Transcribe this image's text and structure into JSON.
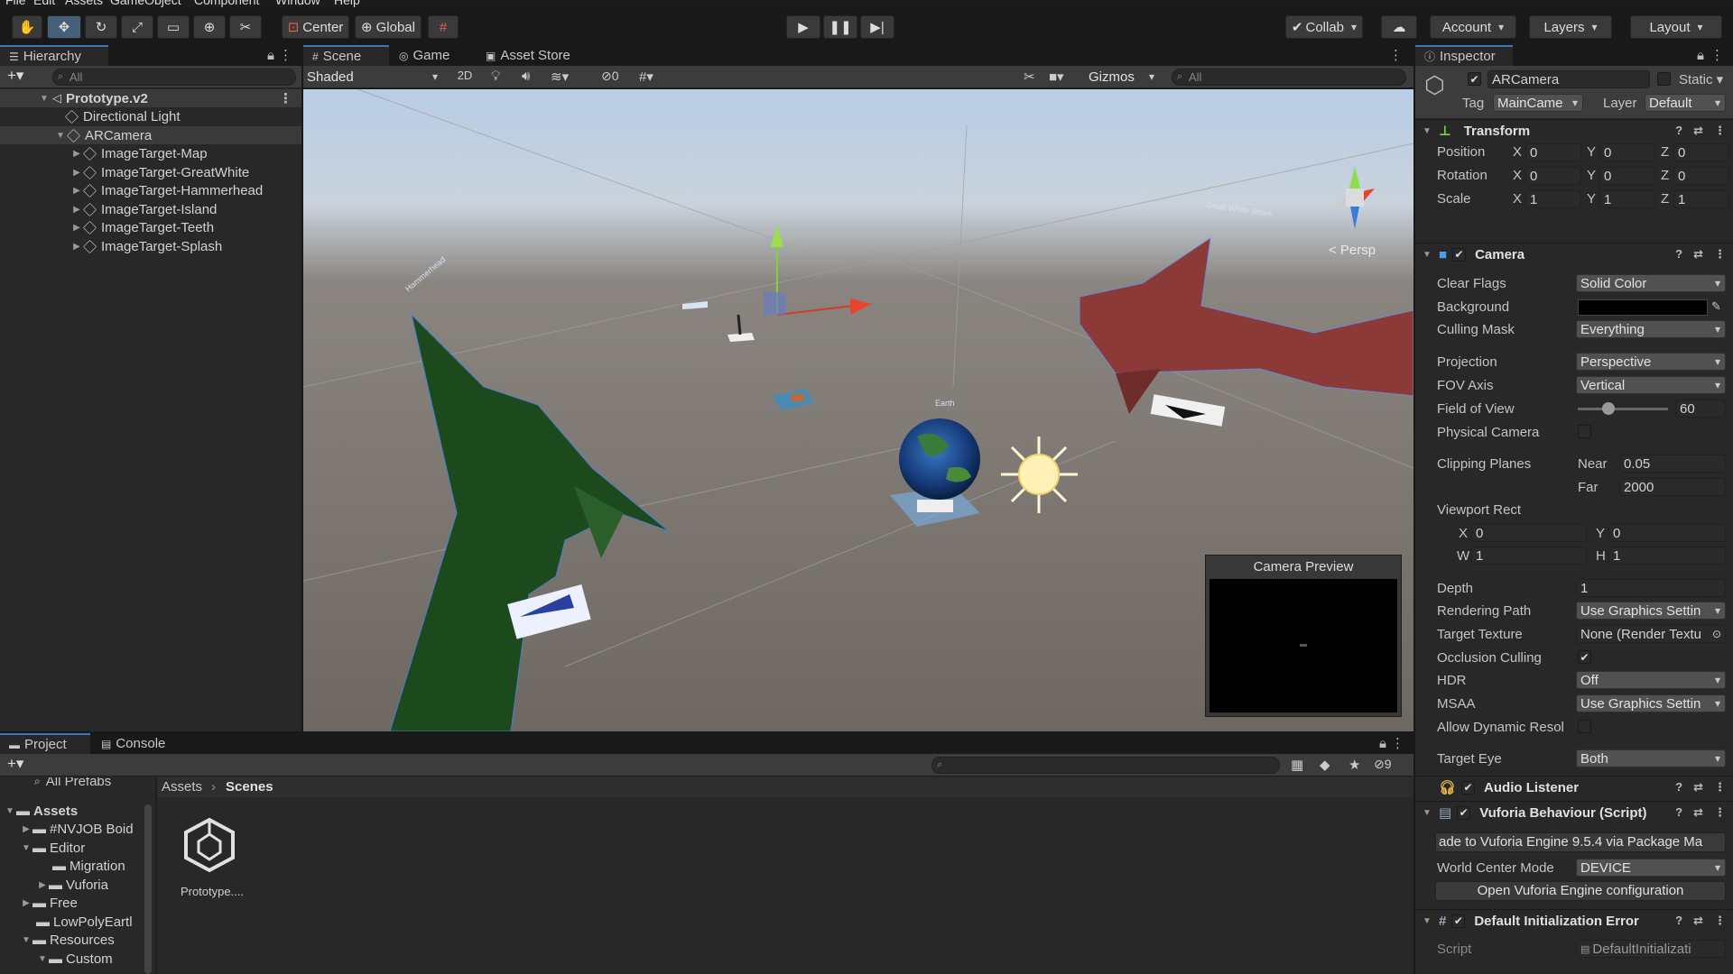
{
  "menu": {
    "items": [
      "File",
      "Edit",
      "Assets",
      "GameObject",
      "Component",
      "Window",
      "Help"
    ]
  },
  "toolbar": {
    "pivot": "Center",
    "space": "Global",
    "collab": "Collab",
    "account": "Account",
    "layers": "Layers",
    "layout": "Layout"
  },
  "hierarchy": {
    "tab": "Hierarchy",
    "search_placeholder": "All",
    "scene": "Prototype.v2",
    "items": [
      {
        "label": "Directional Light"
      },
      {
        "label": "ARCamera"
      },
      {
        "label": "ImageTarget-Map"
      },
      {
        "label": "ImageTarget-GreatWhite"
      },
      {
        "label": "ImageTarget-Hammerhead"
      },
      {
        "label": "ImageTarget-Island"
      },
      {
        "label": "ImageTarget-Teeth"
      },
      {
        "label": "ImageTarget-Splash"
      }
    ]
  },
  "scene_view": {
    "tabs": [
      "Scene",
      "Game",
      "Asset Store"
    ],
    "shading": "Shaded",
    "mode_2d": "2D",
    "hidden_count": "0",
    "gizmos": "Gizmos",
    "search_placeholder": "All",
    "persp": "< Persp",
    "camera_preview_title": "Camera Preview",
    "world_labels": [
      "Great White Shark",
      "Earth",
      "Hammerhead"
    ]
  },
  "inspector": {
    "tab": "Inspector",
    "object_name": "ARCamera",
    "static": "Static",
    "tag_label": "Tag",
    "tag": "MainCame",
    "layer_label": "Layer",
    "layer": "Default",
    "transform": {
      "title": "Transform",
      "position_label": "Position",
      "rotation_label": "Rotation",
      "scale_label": "Scale",
      "position": [
        "0",
        "0",
        "0"
      ],
      "rotation": [
        "0",
        "0",
        "0"
      ],
      "scale": [
        "1",
        "1",
        "1"
      ]
    },
    "camera": {
      "title": "Camera",
      "clear_flags_label": "Clear Flags",
      "clear_flags": "Solid Color",
      "background_label": "Background",
      "background_color": "#000000",
      "culling_mask_label": "Culling Mask",
      "culling_mask": "Everything",
      "projection_label": "Projection",
      "projection": "Perspective",
      "fov_axis_label": "FOV Axis",
      "fov_axis": "Vertical",
      "fov_label": "Field of View",
      "fov": "60",
      "physical_label": "Physical Camera",
      "clipping_label": "Clipping Planes",
      "near_label": "Near",
      "near": "0.05",
      "far_label": "Far",
      "far": "2000",
      "viewport_label": "Viewport Rect",
      "vx": "0",
      "vy": "0",
      "vw": "1",
      "vh": "1",
      "depth_label": "Depth",
      "depth": "1",
      "rendering_path_label": "Rendering Path",
      "rendering_path": "Use Graphics Settin",
      "target_texture_label": "Target Texture",
      "target_texture": "None (Render Textu",
      "occlusion_label": "Occlusion Culling",
      "hdr_label": "HDR",
      "hdr": "Off",
      "msaa_label": "MSAA",
      "msaa": "Use Graphics Settin",
      "dynres_label": "Allow Dynamic Resol",
      "target_eye_label": "Target Eye",
      "target_eye": "Both"
    },
    "audio_listener": {
      "title": "Audio Listener"
    },
    "vuforia": {
      "title": "Vuforia Behaviour (Script)",
      "upgrade_text": "ade to Vuforia Engine 9.5.4 via Package Ma",
      "world_center_label": "World Center Mode",
      "world_center": "DEVICE",
      "open_config": "Open Vuforia Engine configuration"
    },
    "default_init": {
      "title": "Default Initialization Error",
      "script_label": "Script",
      "script": "DefaultInitializati"
    }
  },
  "project": {
    "tabs": [
      "Project",
      "Console"
    ],
    "hidden_count": "9",
    "breadcrumb": [
      "Assets",
      "Scenes"
    ],
    "all_prefabs": "All Prefabs",
    "tree": [
      {
        "label": "Assets",
        "bold": true
      },
      {
        "label": "#NVJOB Boid"
      },
      {
        "label": "Editor"
      },
      {
        "label": "Migration"
      },
      {
        "label": "Vuforia"
      },
      {
        "label": "Free"
      },
      {
        "label": "LowPolyEartl"
      },
      {
        "label": "Resources"
      },
      {
        "label": "Custom"
      }
    ],
    "asset": "Prototype...."
  }
}
